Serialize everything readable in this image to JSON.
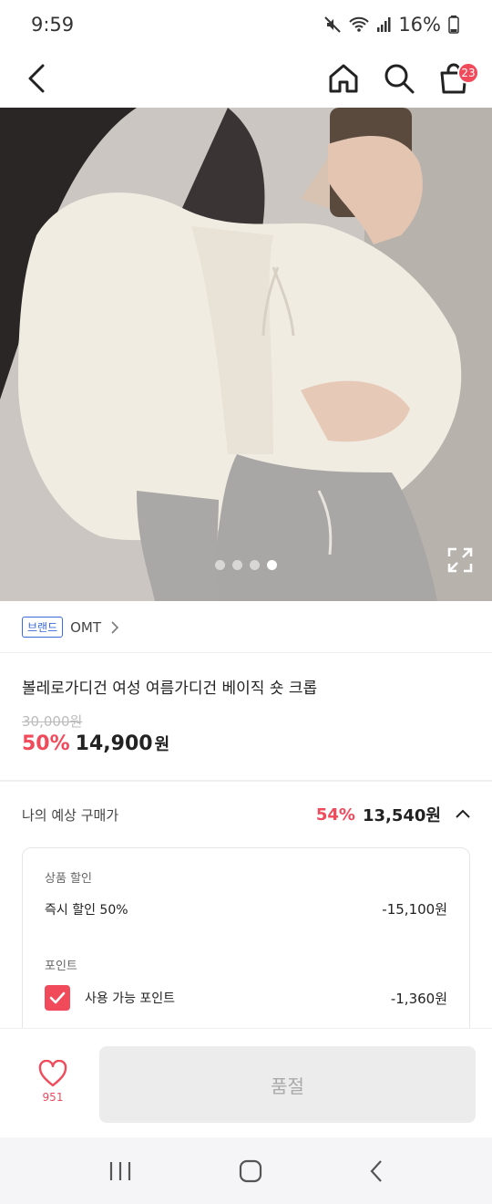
{
  "status": {
    "time": "9:59",
    "battery": "16%"
  },
  "header": {
    "cart_count": "23"
  },
  "gallery": {
    "dots": 4,
    "active_index": 3
  },
  "brand": {
    "tag": "브랜드",
    "name": "OMT"
  },
  "product": {
    "title": "볼레로가디건 여성 여름가디건 베이직 숏 크롭",
    "original_price": "30,000원",
    "discount": "50%",
    "price": "14,900",
    "currency": "원"
  },
  "expected": {
    "label": "나의 예상 구매가",
    "discount": "54%",
    "price": "13,540원"
  },
  "breakdown": {
    "section1_label": "상품 할인",
    "instant_label": "즉시 할인 50%",
    "instant_amount": "-15,100원",
    "section2_label": "포인트",
    "points_label": "사용 가능 포인트",
    "points_amount": "-1,360원"
  },
  "bottom": {
    "like_count": "951",
    "soldout_label": "품절"
  },
  "colors": {
    "accent": "#f04a5b",
    "brand_tag": "#3a6ad6"
  }
}
